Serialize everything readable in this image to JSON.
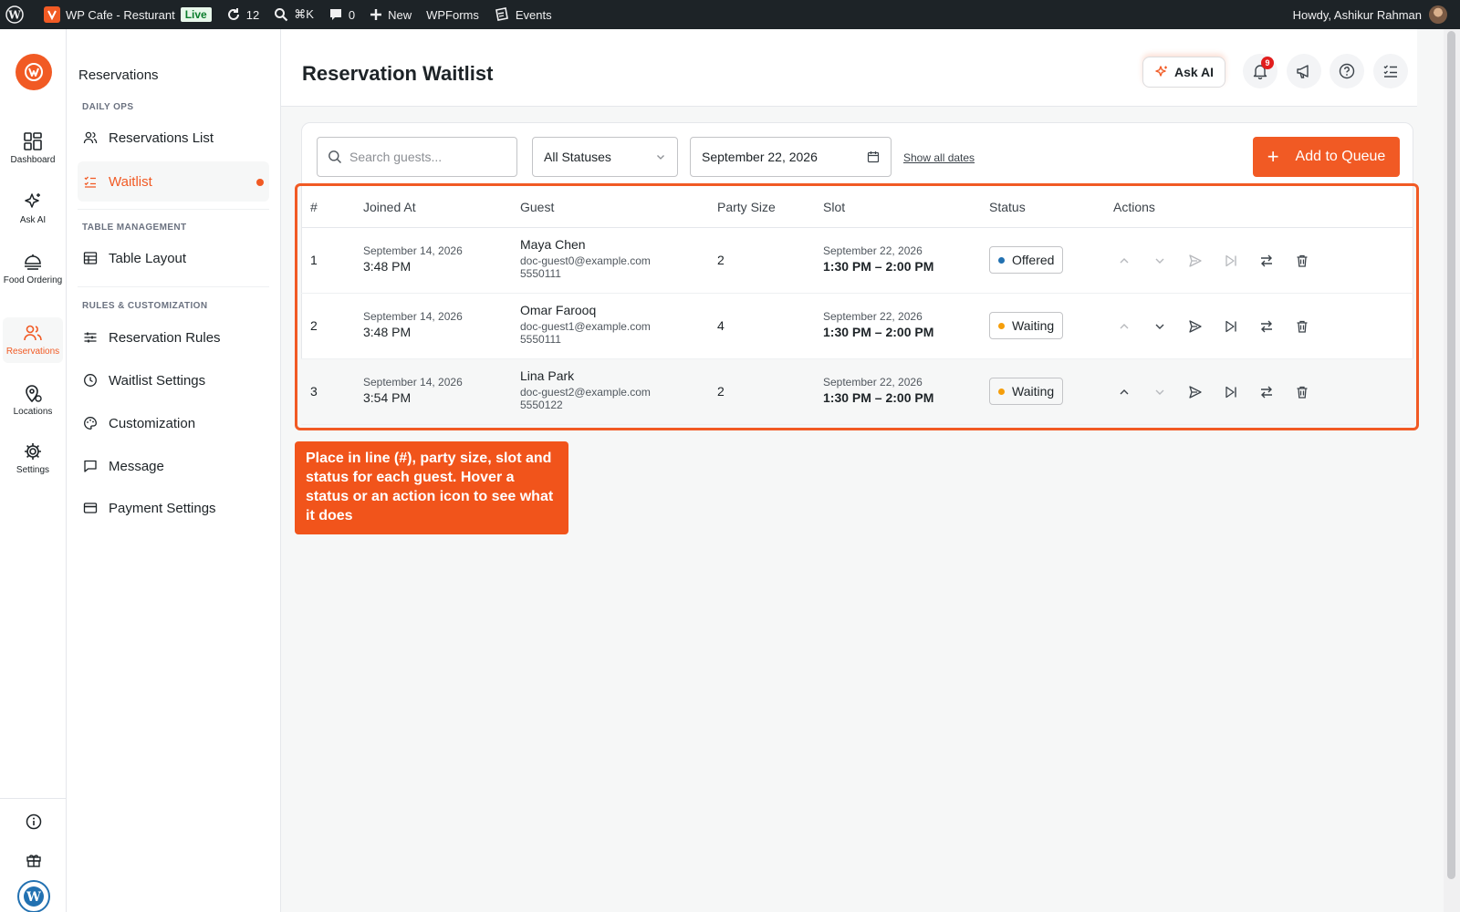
{
  "adminbar": {
    "site_name": "WP Cafe - Resturant",
    "live_badge": "Live",
    "updates_count": "12",
    "search_shortcut": "⌘K",
    "comments_count": "0",
    "new_label": "New",
    "wpforms_label": "WPForms",
    "events_label": "Events",
    "greeting": "Howdy, Ashikur Rahman"
  },
  "rail": {
    "items": [
      {
        "label": "Dashboard",
        "icon": "dashboard-icon"
      },
      {
        "label": "Ask AI",
        "icon": "sparkle-icon"
      },
      {
        "label": "Food Ordering",
        "icon": "food-icon"
      },
      {
        "label": "Reservations",
        "icon": "users-icon",
        "active": true
      },
      {
        "label": "Locations",
        "icon": "location-icon"
      },
      {
        "label": "Settings",
        "icon": "gear-icon"
      }
    ]
  },
  "sidebar": {
    "title": "Reservations",
    "sections": [
      {
        "heading": "DAILY OPS",
        "items": [
          "Reservations List",
          "Waitlist"
        ]
      },
      {
        "heading": "TABLE MANAGEMENT",
        "items": [
          "Table Layout"
        ]
      },
      {
        "heading": "RULES & CUSTOMIZATION",
        "items": [
          "Reservation Rules",
          "Waitlist Settings",
          "Customization",
          "Message",
          "Payment Settings"
        ]
      }
    ],
    "active_item": "Waitlist"
  },
  "header": {
    "title": "Reservation Waitlist",
    "ask_ai_label": "Ask AI",
    "notification_count": "9"
  },
  "toolbar": {
    "search_placeholder": "Search guests...",
    "status_filter": "All Statuses",
    "date_value": "September 22, 2026",
    "show_all_dates": "Show all dates",
    "add_button": "Add to Queue"
  },
  "table": {
    "columns": [
      "#",
      "Joined At",
      "Guest",
      "Party Size",
      "Slot",
      "Status",
      "Actions"
    ],
    "rows": [
      {
        "num": "1",
        "joined_date": "September 14, 2026",
        "joined_time": "3:48 PM",
        "name": "Maya Chen",
        "email": "doc-guest0@example.com",
        "phone": "5550111",
        "party": "2",
        "slot_date": "September 22, 2026",
        "slot_time": "1:30 PM – 2:00 PM",
        "status": "Offered",
        "status_color": "#2271b1"
      },
      {
        "num": "2",
        "joined_date": "September 14, 2026",
        "joined_time": "3:48 PM",
        "name": "Omar Farooq",
        "email": "doc-guest1@example.com",
        "phone": "5550111",
        "party": "4",
        "slot_date": "September 22, 2026",
        "slot_time": "1:30 PM – 2:00 PM",
        "status": "Waiting",
        "status_color": "#f59e0b"
      },
      {
        "num": "3",
        "joined_date": "September 14, 2026",
        "joined_time": "3:54 PM",
        "name": "Lina Park",
        "email": "doc-guest2@example.com",
        "phone": "5550122",
        "party": "2",
        "slot_date": "September 22, 2026",
        "slot_time": "1:30 PM – 2:00 PM",
        "status": "Waiting",
        "status_color": "#f59e0b"
      }
    ]
  },
  "tooltip": {
    "text": "Place in line (#), party size, slot and status for each guest. Hover a status or an action icon to see what it does"
  },
  "colors": {
    "accent": "#f15a24",
    "adminbar": "#1d2327"
  }
}
